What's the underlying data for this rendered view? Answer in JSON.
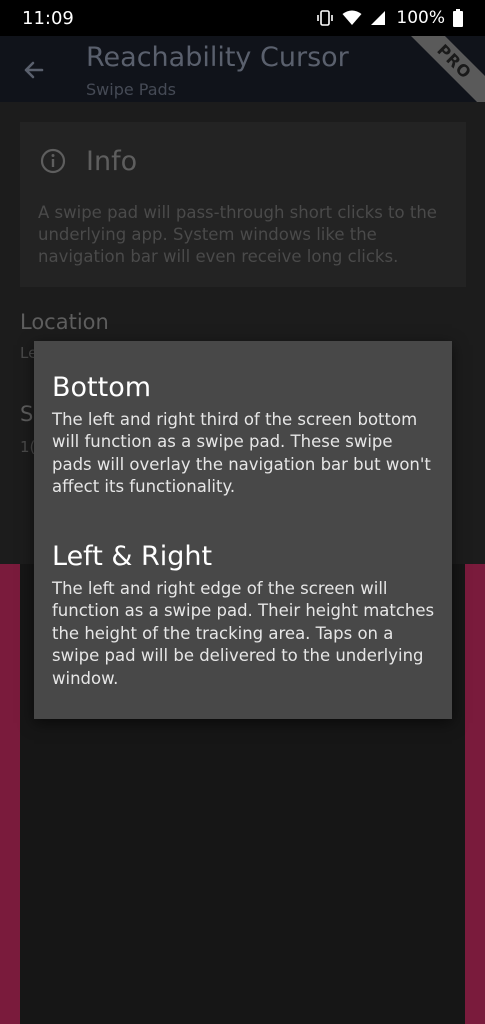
{
  "status_bar": {
    "time": "11:09",
    "battery": "100%",
    "icons": [
      "vibrate-icon",
      "wifi-icon",
      "signal-icon",
      "battery-icon"
    ]
  },
  "app_bar": {
    "title": "Reachability Cursor",
    "subtitle": "Swipe Pads",
    "badge": "PRO",
    "back_icon": "arrow-back-icon"
  },
  "info_card": {
    "title": "Info",
    "icon": "info-icon",
    "text": "A swipe pad will pass-through short clicks to the underlying app. System windows like the navigation bar will even receive long clicks."
  },
  "settings": {
    "location_title": "Location",
    "location_value": "Le",
    "size_title": "S",
    "size_value": "1("
  },
  "popup": {
    "options": [
      {
        "title": "Bottom",
        "description": "The left and right third of the screen bottom will function as a swipe pad. These swipe pads will overlay the navigation bar but won't affect its functionality."
      },
      {
        "title": "Left & Right",
        "description": "The left and right edge of the screen will function as a swipe pad. Their height matches the height of the tracking area. Taps on a swipe pad will be delivered to the underlying window."
      }
    ]
  },
  "colors": {
    "accent_pad": "#7a1b3c",
    "popup_bg": "#484848",
    "app_bar_bg": "#10131a"
  }
}
